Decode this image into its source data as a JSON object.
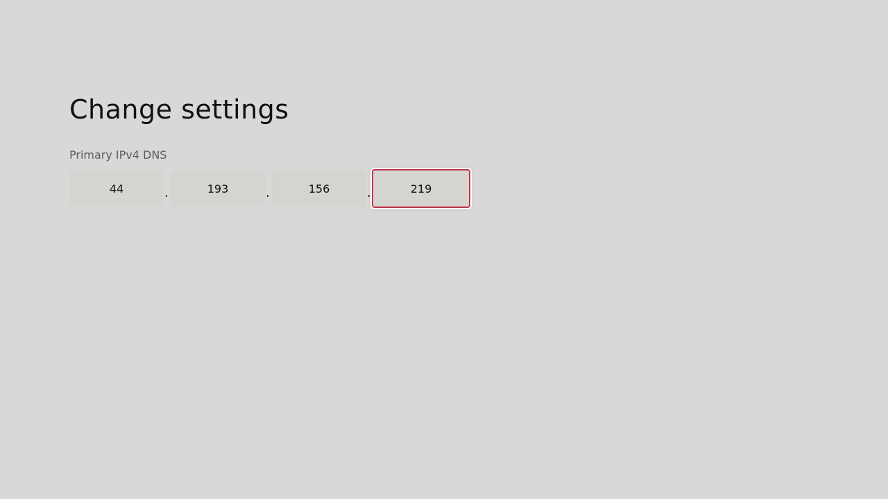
{
  "page": {
    "title": "Change settings"
  },
  "dns": {
    "label": "Primary IPv4 DNS",
    "separator": ".",
    "octets": [
      "44",
      "193",
      "156",
      "219"
    ],
    "focused_index": 3
  },
  "colors": {
    "background": "#d8d8d8",
    "field_background": "#d4d4d0",
    "focus_border": "#c0324a"
  }
}
